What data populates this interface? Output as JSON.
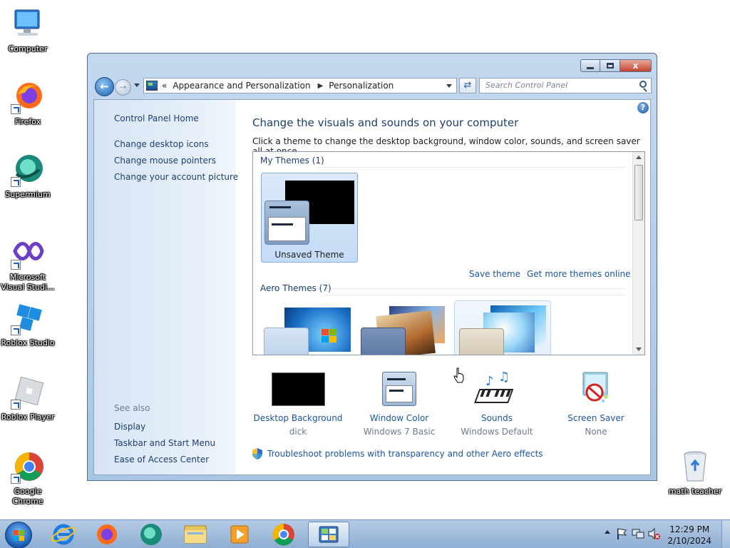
{
  "desktop": {
    "icons": [
      {
        "label": "Computer"
      },
      {
        "label": "Firefox"
      },
      {
        "label": "Supermium"
      },
      {
        "label": "Microsoft Visual Studi..."
      },
      {
        "label": "Roblox Studio"
      },
      {
        "label": "Roblox Player"
      },
      {
        "label": "Google Chrome"
      },
      {
        "label": "math teacher"
      }
    ]
  },
  "window": {
    "address": {
      "chevron": "«",
      "crumb1": "Appearance and Personalization",
      "crumb2": "Personalization"
    },
    "search_placeholder": "Search Control Panel",
    "close_glyph": "x",
    "help_glyph": "?"
  },
  "left_pane": {
    "home": "Control Panel Home",
    "links": [
      "Change desktop icons",
      "Change mouse pointers",
      "Change your account picture"
    ],
    "see_also_label": "See also",
    "see_also": [
      "Display",
      "Taskbar and Start Menu",
      "Ease of Access Center"
    ]
  },
  "main": {
    "title": "Change the visuals and sounds on your computer",
    "subtitle": "Click a theme to change the desktop background, window color, sounds, and screen saver all at once.",
    "my_themes_label": "My Themes (1)",
    "unsaved_theme": "Unsaved Theme",
    "save_theme": "Save theme",
    "get_more": "Get more themes online",
    "aero_label": "Aero Themes (7)",
    "bottom": [
      {
        "caption": "Desktop Background",
        "value": "dick"
      },
      {
        "caption": "Window Color",
        "value": "Windows 7 Basic"
      },
      {
        "caption": "Sounds",
        "value": "Windows Default"
      },
      {
        "caption": "Screen Saver",
        "value": "None"
      }
    ],
    "troubleshoot": "Troubleshoot problems with transparency and other Aero effects"
  },
  "taskbar": {
    "time": "12:29 PM",
    "date": "2/10/2024"
  }
}
